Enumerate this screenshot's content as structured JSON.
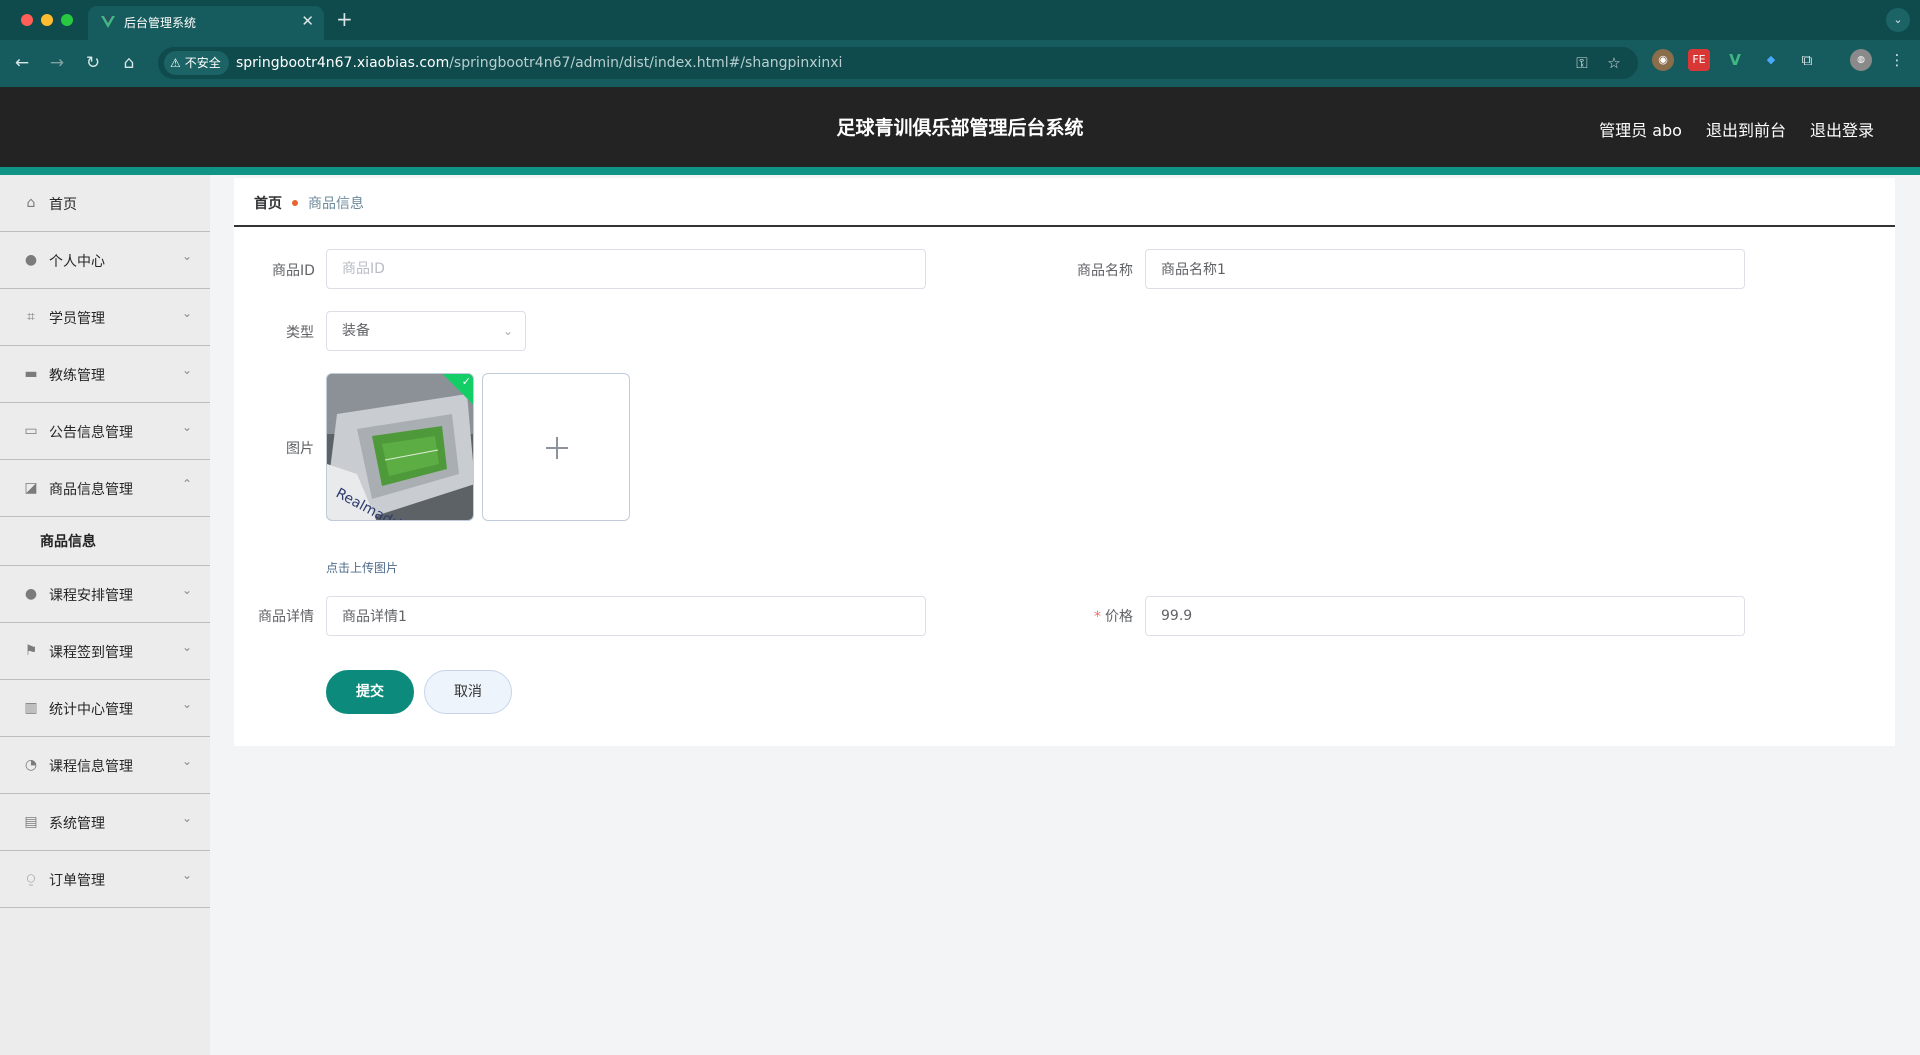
{
  "browser": {
    "tab_title": "后台管理系统",
    "new_tab": "+",
    "security_label": "不安全",
    "url_host": "springbootr4n67.xiaobias.com",
    "url_path": "/springbootr4n67/admin/dist/index.html#/shangpinxinxi"
  },
  "header": {
    "title": "足球青训俱乐部管理后台系统",
    "admin_label": "管理员 abo",
    "exit_front": "退出到前台",
    "logout": "退出登录"
  },
  "sidebar": {
    "items": [
      {
        "label": "首页",
        "icon": "home-icon"
      },
      {
        "label": "个人中心",
        "icon": "user-icon"
      },
      {
        "label": "学员管理",
        "icon": "crop-icon"
      },
      {
        "label": "教练管理",
        "icon": "briefcase-icon"
      },
      {
        "label": "公告信息管理",
        "icon": "id-card-icon"
      },
      {
        "label": "商品信息管理",
        "icon": "chart-icon",
        "expanded": true
      },
      {
        "label": "课程安排管理",
        "icon": "user-icon"
      },
      {
        "label": "课程签到管理",
        "icon": "flag-icon"
      },
      {
        "label": "统计中心管理",
        "icon": "bar-chart-icon"
      },
      {
        "label": "课程信息管理",
        "icon": "compass-icon"
      },
      {
        "label": "系统管理",
        "icon": "clipboard-icon"
      },
      {
        "label": "订单管理",
        "icon": "microphone-icon"
      }
    ],
    "sub_items": [
      {
        "label": "商品信息"
      }
    ]
  },
  "breadcrumb": {
    "home": "首页",
    "current": "商品信息"
  },
  "form": {
    "product_id": {
      "label": "商品ID",
      "value": "",
      "placeholder": "商品ID"
    },
    "product_name": {
      "label": "商品名称",
      "value": "商品名称1",
      "placeholder": "商品名称"
    },
    "type": {
      "label": "类型",
      "value": "装备"
    },
    "image": {
      "label": "图片",
      "upload_tip": "点击上传图片"
    },
    "detail": {
      "label": "商品详情",
      "value": "商品详情1",
      "placeholder": "商品详情"
    },
    "price": {
      "label": "价格",
      "required_mark": "*",
      "value": "99.9",
      "placeholder": "价格"
    },
    "submit": "提交",
    "cancel": "取消"
  },
  "colors": {
    "header_bg": "#232323",
    "accent": "#0f9486",
    "submit": "#0c8b7c",
    "sidebar_bg": "#ececec",
    "browser_tab_bg": "#0f4a4c"
  }
}
